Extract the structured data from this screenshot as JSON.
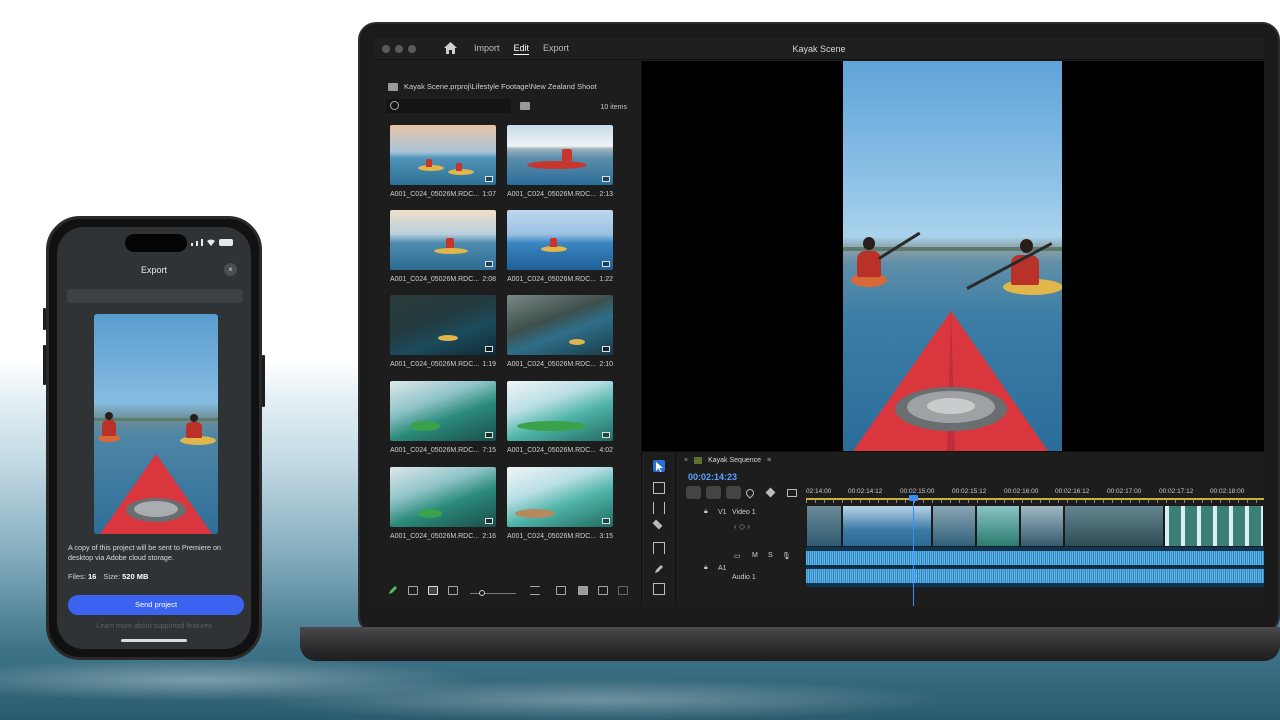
{
  "laptop": {
    "window_title": "Kayak Scene",
    "menu": [
      "Import",
      "Edit",
      "Export"
    ],
    "active_menu": "Edit",
    "project": {
      "path": "Kayak Scene.prproj\\Lifestyle Footage\\New Zealand Shoot",
      "items_count": "10 items",
      "clips": [
        {
          "name": "A001_C024_05026M.RDC...",
          "duration": "1:07"
        },
        {
          "name": "A001_C024_05026M.RDC...",
          "duration": "2:13"
        },
        {
          "name": "A001_C024_05026M.RDC...",
          "duration": "2:08"
        },
        {
          "name": "A001_C024_05026M.RDC...",
          "duration": "1:22"
        },
        {
          "name": "A001_C024_05026M.RDC...",
          "duration": "1:19"
        },
        {
          "name": "A001_C024_05026M.RDC...",
          "duration": "2:10"
        },
        {
          "name": "A001_C024_05026M.RDC...",
          "duration": "7:15"
        },
        {
          "name": "A001_C024_05026M.RDC...",
          "duration": "4:02"
        },
        {
          "name": "A001_C024_05026M.RDC...",
          "duration": "2:16"
        },
        {
          "name": "A001_C024_05026M.RDC...",
          "duration": "3:15"
        }
      ]
    },
    "timeline": {
      "sequence_name": "Kayak Sequence",
      "timecode": "00:02:14:23",
      "ruler": [
        "02:14:00",
        "00:02:14:12",
        "00:02:15:00",
        "00:02:15:12",
        "00:02:16:00",
        "00:02:16:12",
        "00:02:17:00",
        "00:02:17:12",
        "00:02:18:00"
      ],
      "video_track": {
        "id": "V1",
        "name": "Video 1"
      },
      "audio_track": {
        "id": "A1",
        "name": "Audio 1",
        "m": "M",
        "s": "S"
      }
    }
  },
  "phone": {
    "title": "Export",
    "close": "×",
    "description": "A copy of this project will be sent to Premiere on desktop via Adobe cloud storage.",
    "files_label": "Files:",
    "files_value": "16",
    "size_label": "Size:",
    "size_value": "520 MB",
    "send_button": "Send project",
    "more_link": "Learn more about supported features"
  },
  "colors": {
    "accent_blue": "#3b63f0",
    "timecode_blue": "#5aa2ff",
    "audio_track": "#0f3552"
  }
}
